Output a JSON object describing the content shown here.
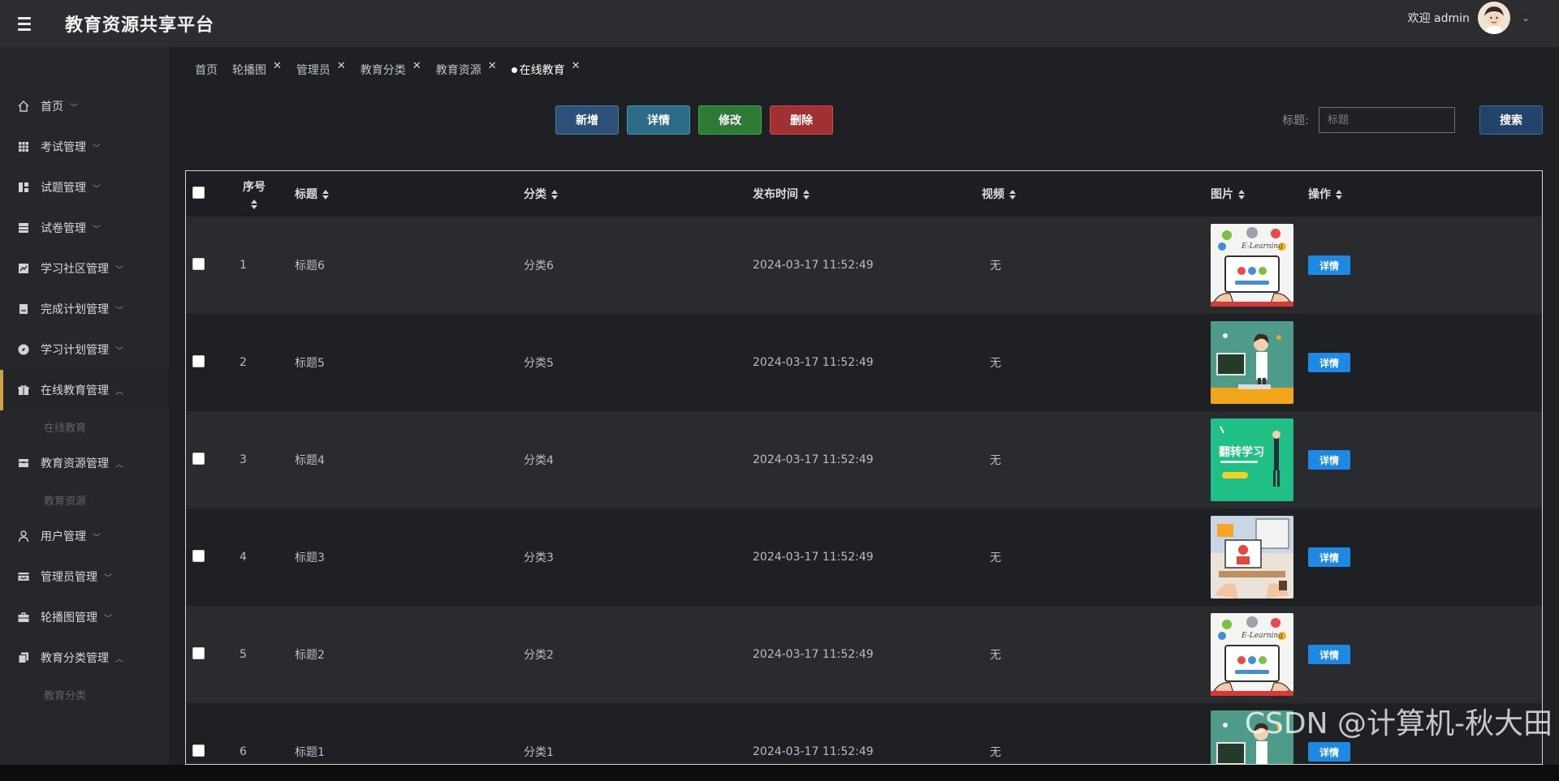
{
  "app": {
    "title": "教育资源共享平台",
    "welcome": "欢迎 admin"
  },
  "sidebar": {
    "items": [
      {
        "label": "首页",
        "icon": "home-icon",
        "expanded": false
      },
      {
        "label": "考试管理",
        "icon": "grid-icon",
        "expanded": false
      },
      {
        "label": "试题管理",
        "icon": "layout-icon",
        "expanded": false
      },
      {
        "label": "试卷管理",
        "icon": "database-icon",
        "expanded": false
      },
      {
        "label": "学习社区管理",
        "icon": "chart-icon",
        "expanded": false
      },
      {
        "label": "完成计划管理",
        "icon": "doc-icon",
        "expanded": false
      },
      {
        "label": "学习计划管理",
        "icon": "compass-icon",
        "expanded": false
      },
      {
        "label": "在线教育管理",
        "icon": "gift-icon",
        "expanded": true,
        "sub": "在线教育"
      },
      {
        "label": "教育资源管理",
        "icon": "box-icon",
        "expanded": true,
        "sub": "教育资源"
      },
      {
        "label": "用户管理",
        "icon": "user-icon",
        "expanded": false
      },
      {
        "label": "管理员管理",
        "icon": "card-icon",
        "expanded": false
      },
      {
        "label": "轮播图管理",
        "icon": "briefcase-icon",
        "expanded": false
      },
      {
        "label": "教育分类管理",
        "icon": "copy-icon",
        "expanded": true,
        "sub": "教育分类"
      }
    ]
  },
  "tabs": [
    {
      "label": "首页",
      "closable": false,
      "current": false
    },
    {
      "label": "轮播图",
      "closable": true,
      "current": false
    },
    {
      "label": "管理员",
      "closable": true,
      "current": false
    },
    {
      "label": "教育分类",
      "closable": true,
      "current": false
    },
    {
      "label": "教育资源",
      "closable": true,
      "current": false
    },
    {
      "label": "在线教育",
      "closable": true,
      "current": true
    }
  ],
  "toolbar": {
    "add": "新增",
    "detail": "详情",
    "edit": "修改",
    "delete": "删除"
  },
  "search": {
    "label": "标题:",
    "placeholder": "标题",
    "button": "搜索"
  },
  "table": {
    "headers": {
      "index": "序号",
      "title": "标题",
      "category": "分类",
      "time": "发布时间",
      "video": "视频",
      "image": "图片",
      "action": "操作"
    },
    "rows": [
      {
        "index": "1",
        "title": "标题6",
        "category": "分类6",
        "time": "2024-03-17 11:52:49",
        "video": "无",
        "image": "elearning",
        "action": "详情"
      },
      {
        "index": "2",
        "title": "标题5",
        "category": "分类5",
        "time": "2024-03-17 11:52:49",
        "video": "无",
        "image": "teacher",
        "action": "详情"
      },
      {
        "index": "3",
        "title": "标题4",
        "category": "分类4",
        "time": "2024-03-17 11:52:49",
        "video": "无",
        "image": "green-poster",
        "action": "详情"
      },
      {
        "index": "4",
        "title": "标题3",
        "category": "分类3",
        "time": "2024-03-17 11:52:49",
        "video": "无",
        "image": "video-call",
        "action": "详情"
      },
      {
        "index": "5",
        "title": "标题2",
        "category": "分类2",
        "time": "2024-03-17 11:52:49",
        "video": "无",
        "image": "elearning",
        "action": "详情"
      },
      {
        "index": "6",
        "title": "标题1",
        "category": "分类1",
        "time": "2024-03-17 11:52:49",
        "video": "无",
        "image": "teacher",
        "action": "详情"
      }
    ]
  },
  "watermark": "CSDN @计算机-秋大田",
  "colors": {
    "accent": "#1e88e5",
    "add": "#2c5077",
    "detail": "#2c6b85",
    "edit": "#2d7a36",
    "delete": "#a23032"
  }
}
